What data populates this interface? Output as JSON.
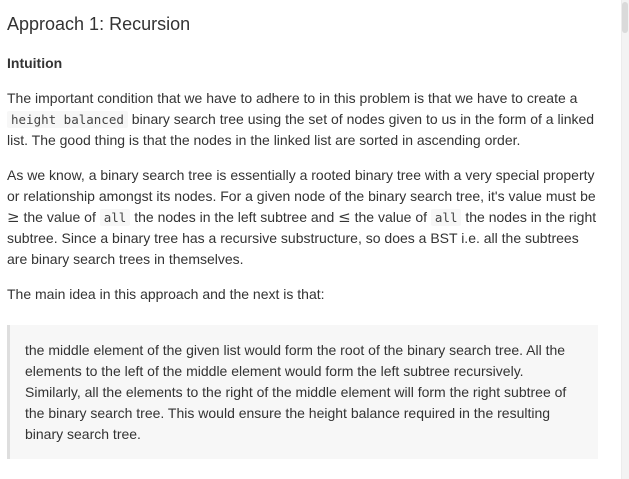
{
  "heading": "Approach 1: Recursion",
  "subheading": "Intuition",
  "paragraph1": {
    "before_code": "The important condition that we have to adhere to in this problem is that we have to create a ",
    "code": "height balanced",
    "after_code": " binary search tree using the set of nodes given to us in the form of a linked list. The good thing is that the nodes in the linked list are sorted in ascending order."
  },
  "paragraph2": {
    "text_a": "As we know, a binary search tree is essentially a rooted binary tree with a very special property or relationship amongst its nodes. For a given node of the binary search tree, it's value must be ",
    "symbol_ge": "≥",
    "text_b": " the value of ",
    "code_all_1": "all",
    "text_c": " the nodes in the left subtree and ",
    "symbol_le": "≤",
    "text_d": " the value of ",
    "code_all_2": "all",
    "text_e": " the nodes in the right subtree. Since a binary tree has a recursive substructure, so does a BST i.e. all the subtrees are binary search trees in themselves."
  },
  "paragraph3": "The main idea in this approach and the next is that:",
  "quote": "the middle element of the given list would form the root of the binary search tree. All the elements to the left of the middle element would form the left subtree recursively. Similarly, all the elements to the right of the middle element will form the right subtree of the binary search tree. This would ensure the height balance required in the resulting binary search tree."
}
